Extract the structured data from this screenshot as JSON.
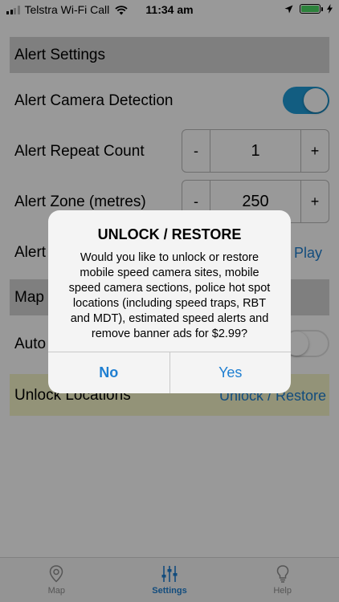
{
  "status_bar": {
    "carrier": "Telstra Wi-Fi Call",
    "time": "11:34 am",
    "battery_color": "#4cd964"
  },
  "settings": {
    "alert_header": "Alert Settings",
    "camera_detection_label": "Alert Camera Detection",
    "camera_detection_on": true,
    "repeat_count_label": "Alert Repeat Count",
    "repeat_count_value": "1",
    "zone_label": "Alert Zone (metres)",
    "zone_value": "250",
    "stepper_minus": "-",
    "stepper_plus": "+",
    "alert_partial_label": "Alert",
    "play_link": "Play",
    "map_header_partial": "Map",
    "auto_partial_label": "Auto",
    "auto_toggle_on": false,
    "unlock_label": "Unlock Locations",
    "unlock_link": "Unlock / Restore",
    "accent_color": "#1e9bd7"
  },
  "dialog": {
    "title": "UNLOCK / RESTORE",
    "message": "Would you like to unlock or restore mobile speed camera sites, mobile speed camera sections, police hot spot locations (including speed traps, RBT and MDT), estimated speed alerts and remove banner ads for $2.99?",
    "no_label": "No",
    "yes_label": "Yes"
  },
  "tabs": [
    {
      "label": "Map",
      "icon": "map-pin-icon",
      "active": false
    },
    {
      "label": "Settings",
      "icon": "sliders-icon",
      "active": true
    },
    {
      "label": "Help",
      "icon": "lightbulb-icon",
      "active": false
    }
  ]
}
